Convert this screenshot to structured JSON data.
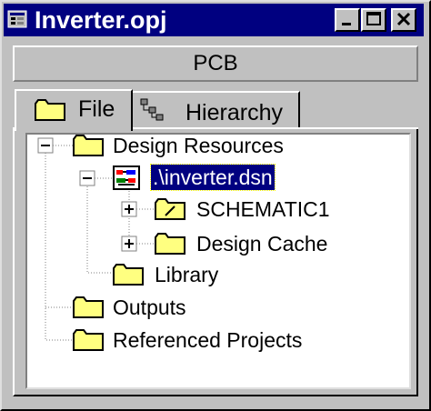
{
  "window": {
    "title": "Inverter.opj"
  },
  "toolbar": {
    "pcb_label": "PCB"
  },
  "tabs": [
    {
      "label": "File"
    },
    {
      "label": "Hierarchy"
    }
  ],
  "tree": {
    "design_resources": "Design Resources",
    "dsn_file": ".\\inverter.dsn",
    "schematic": "SCHEMATIC1",
    "design_cache": "Design Cache",
    "library": "Library",
    "outputs": "Outputs",
    "referenced_projects": "Referenced Projects"
  },
  "colors": {
    "titlebar": "#000080",
    "folder": "#ffff80",
    "selection": "#000080",
    "face": "#c0c0c0"
  }
}
